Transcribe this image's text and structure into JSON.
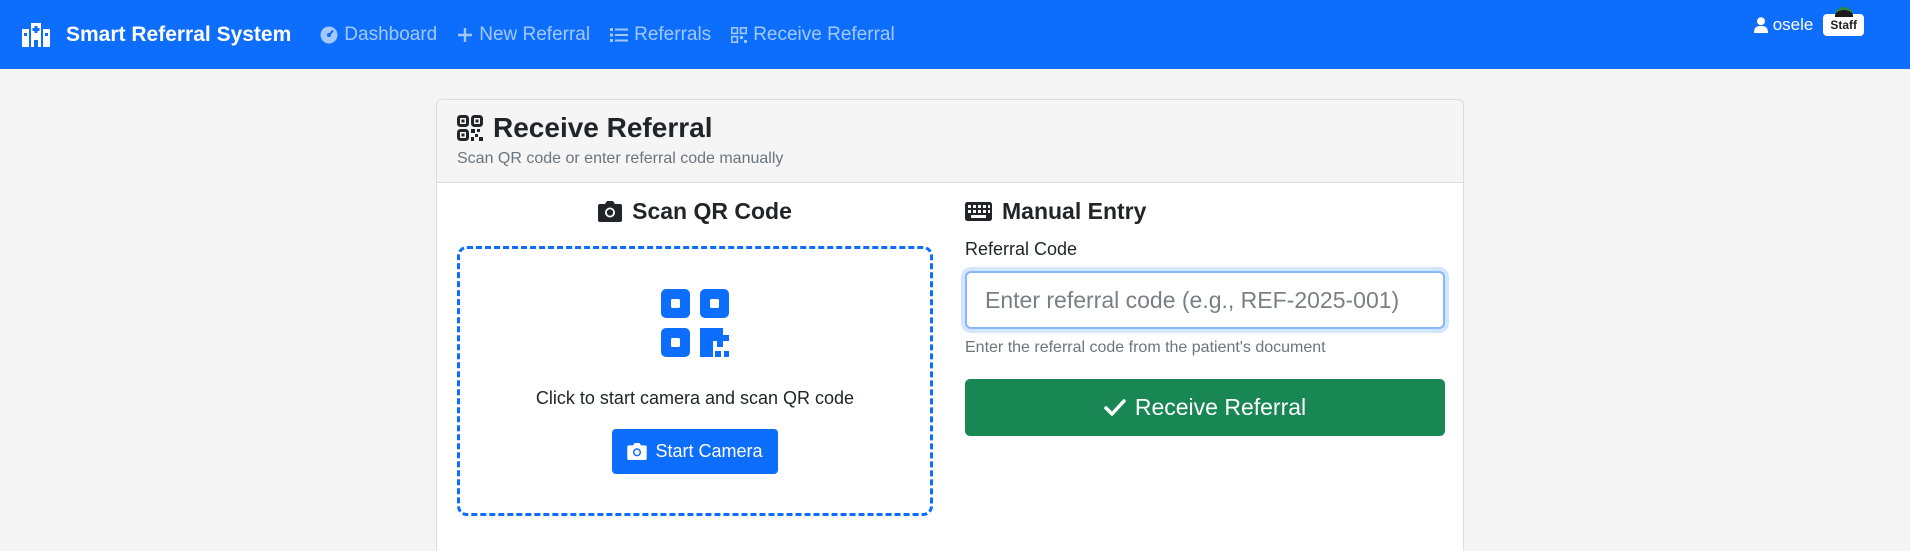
{
  "navbar": {
    "brand": "Smart Referral System",
    "links": [
      {
        "label": "Dashboard",
        "icon": "dashboard-icon"
      },
      {
        "label": "New Referral",
        "icon": "plus-icon"
      },
      {
        "label": "Referrals",
        "icon": "list-icon"
      },
      {
        "label": "Receive Referral",
        "icon": "qr-icon"
      }
    ],
    "username": "osele",
    "role_badge": "Staff"
  },
  "card": {
    "title": "Receive Referral",
    "subtitle": "Scan QR code or enter referral code manually"
  },
  "scan": {
    "title": "Scan QR Code",
    "instruction": "Click to start camera and scan QR code",
    "button_label": "Start Camera"
  },
  "manual": {
    "title": "Manual Entry",
    "field_label": "Referral Code",
    "placeholder": "Enter referral code (e.g., REF-2025-001)",
    "value": "",
    "help_text": "Enter the referral code from the patient's document",
    "submit_label": "Receive Referral"
  },
  "colors": {
    "primary": "#0d6efd",
    "success": "#198754",
    "page_bg": "#f4f4f4"
  }
}
